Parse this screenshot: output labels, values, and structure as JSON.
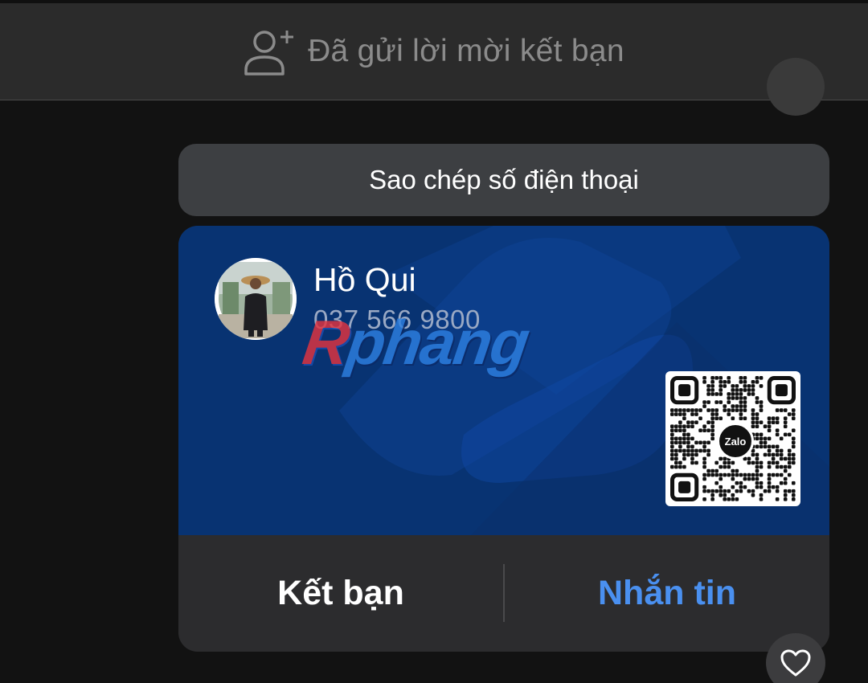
{
  "banner": {
    "icon": "add-person-icon",
    "label": "Đã gửi lời mời kết bạn"
  },
  "copy_button": {
    "label": "Sao chép số điện thoại"
  },
  "contact_card": {
    "name": "Hồ Qui",
    "phone": "037 566 9800",
    "qr_logo_text": "Zalo",
    "watermark_text": "Rphang",
    "actions": {
      "add_friend": "Kết bạn",
      "message": "Nhắn tin"
    }
  },
  "reaction": {
    "icon": "heart-icon"
  },
  "colors": {
    "card_bg": "#083372",
    "action_blue": "#4a90f0",
    "panel": "#2c2c2e"
  }
}
